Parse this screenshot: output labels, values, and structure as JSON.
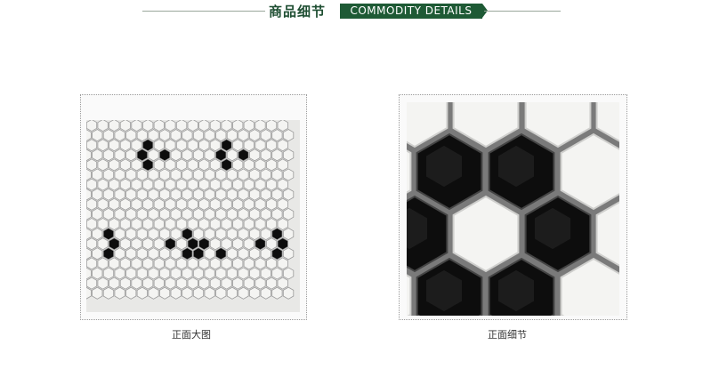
{
  "header": {
    "title_cn": "商品细节",
    "title_en": "COMMODITY DETAILS"
  },
  "panels": [
    {
      "caption": "正面大图"
    },
    {
      "caption": "正面细节"
    }
  ],
  "colors": {
    "brand_green": "#1e5a35",
    "tile_white": "#f4f4f2",
    "tile_black": "#0d0d0d",
    "grout": "#7a7a7a"
  }
}
